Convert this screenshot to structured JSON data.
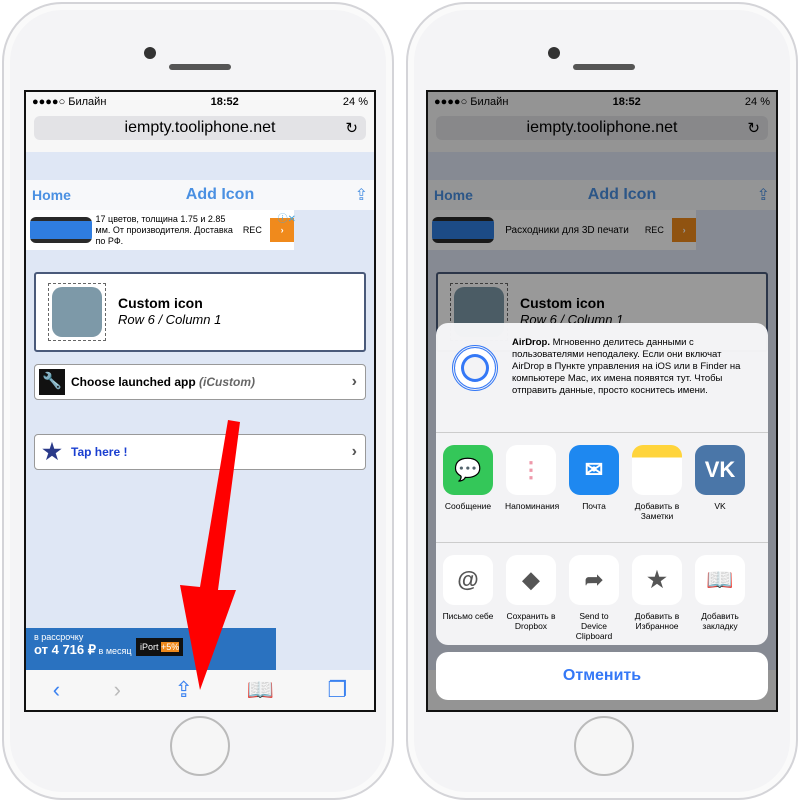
{
  "status": {
    "carrier": "●●●●○ Билайн",
    "time": "18:52",
    "battery": "24 %"
  },
  "browser": {
    "url": "iempty.tooliphone.net",
    "reload_icon": "↻"
  },
  "nav": {
    "home": "Home",
    "title": "Add Icon"
  },
  "left": {
    "ad_text": "17 цветов, толщина 1.75 и 2.85 мм. От производителя. Доставка по РФ.",
    "rec": "REC"
  },
  "right": {
    "ad_text": "Расходники для 3D печати",
    "rec": "REC"
  },
  "custom": {
    "title": "Custom icon",
    "subtitle": "Row 6 / Column 1"
  },
  "choose": {
    "label": "Choose launched app",
    "app": "(iCustom)"
  },
  "tap": {
    "label": "Tap here !"
  },
  "bottom_ad": {
    "line1": "в рассрочку",
    "line2": "от 4 716 ₽",
    "line2b": "в месяц",
    "brand": "iPort",
    "badge": "+5%"
  },
  "share": {
    "airdrop_title": "AirDrop.",
    "airdrop_text": "Мгновенно делитесь данными с пользователями неподалеку. Если они включат AirDrop в Пункте управления на iOS или в Finder на компьютере Mac, их имена появятся тут. Чтобы отправить данные, просто коснитесь имени.",
    "apps": [
      {
        "label": "Сообщение",
        "color": "#34c759"
      },
      {
        "label": "Напоминания",
        "color": "#ffffff"
      },
      {
        "label": "Почта",
        "color": "#1e88f0"
      },
      {
        "label": "Добавить в Заметки",
        "color": "#ffd43b"
      },
      {
        "label": "VK",
        "color": "#4a76a8",
        "glyph": "VK"
      }
    ],
    "actions": [
      {
        "label": "Письмо себе",
        "glyph": "@"
      },
      {
        "label": "Сохранить в Dropbox",
        "glyph": "◆"
      },
      {
        "label": "Send to Device Clipboard",
        "glyph": "➦"
      },
      {
        "label": "Добавить в Избранное",
        "glyph": "★"
      },
      {
        "label": "Добавить закладку",
        "glyph": "📖"
      }
    ],
    "cancel": "Отменить"
  }
}
